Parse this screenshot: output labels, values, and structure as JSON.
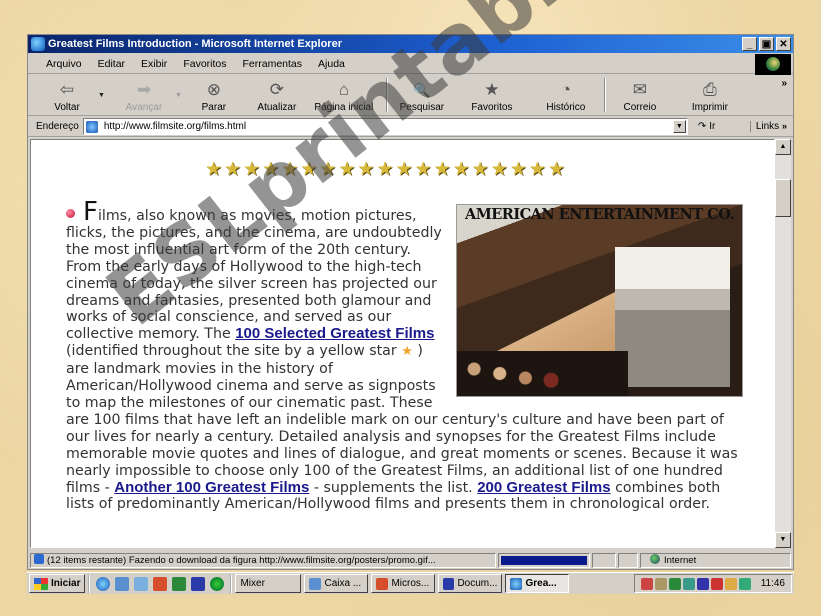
{
  "window": {
    "title": "Greatest Films Introduction - Microsoft Internet Explorer",
    "controls": {
      "minimize": "_",
      "restore": "▣",
      "close": "✕"
    }
  },
  "menu": [
    "Arquivo",
    "Editar",
    "Exibir",
    "Favoritos",
    "Ferramentas",
    "Ajuda"
  ],
  "menu_access_keys": [
    "A",
    "E",
    "x",
    "F",
    "m",
    "j"
  ],
  "toolbar": {
    "buttons": [
      {
        "label": "Voltar",
        "icon": "back-arrow-icon",
        "glyph": "⇦",
        "enabled": true,
        "dropdown": true
      },
      {
        "label": "Avançar",
        "icon": "forward-arrow-icon",
        "glyph": "➡",
        "enabled": false,
        "dropdown": true
      },
      {
        "label": "Parar",
        "icon": "stop-icon",
        "glyph": "⊗",
        "enabled": true
      },
      {
        "label": "Atualizar",
        "icon": "refresh-icon",
        "glyph": "⟳",
        "enabled": true
      },
      {
        "label": "Página inicial",
        "icon": "home-icon",
        "glyph": "⌂",
        "enabled": true
      },
      {
        "label": "Pesquisar",
        "icon": "search-icon",
        "glyph": "🔍",
        "enabled": true
      },
      {
        "label": "Favoritos",
        "icon": "favorites-folder-icon",
        "glyph": "★",
        "enabled": true
      },
      {
        "label": "Histórico",
        "icon": "history-icon",
        "glyph": "◔",
        "enabled": true
      },
      {
        "label": "Correio",
        "icon": "mail-icon",
        "glyph": "✉",
        "enabled": true,
        "dropdown": true
      },
      {
        "label": "Imprimir",
        "icon": "printer-icon",
        "glyph": "⎙",
        "enabled": true
      }
    ],
    "more": "»"
  },
  "address": {
    "label": "Endereço",
    "url": "http://www.filmsite.org/films.html",
    "go_label": "Ir",
    "links_label": "Links",
    "links_more": "»"
  },
  "page": {
    "star_count": 19,
    "star_glyph": "★",
    "poster_title": "AMERICAN ENTERTAINMENT CO.",
    "paragraph": {
      "dropcap": "F",
      "part1": "ilms, also known as movies, motion pictures, flicks, the pictures, and the cinema, are undoubtedly the most influential art form of the 20th century. From the early days of Hollywood to the high-tech cinema of today, the silver screen has projected our dreams and fantasies, presented both glamour and works of social conscience, and served as our collective memory. The ",
      "link1": "100 Selected Greatest Films",
      "part2": " (identified throughout the site by a yellow star ",
      "part3": " ) are landmark movies in the history of American/Hollywood cinema and serve as signposts to map the milestones of our cinematic past. These are 100 films that have left an indelible mark on our century's culture and have been part of our lives for nearly a century. Detailed analysis and synopses for the Greatest Films include memorable movie quotes and lines of dialogue, and great moments or scenes. Because it was nearly impossible to choose only 100 of the Greatest Films, an additional list of one hundred films - ",
      "link2": "Another 100 Greatest Films",
      "part4": " - supplements the list. ",
      "link3": "200 Greatest Films",
      "part5": " combines both lists of predominantly American/Hollywood films and presents them in chronological order."
    }
  },
  "status": {
    "message": "(12 items restante) Fazendo o download da figura http://www.filmsite.org/posters/promo.gif...",
    "progress": 1.0,
    "zone": "Internet"
  },
  "taskbar": {
    "start_label": "Iniciar",
    "quick_launch": [
      "ie-icon",
      "outlook-icon",
      "edit-icon",
      "powerpoint-icon",
      "excel-icon",
      "word-icon",
      "clover-icon"
    ],
    "tasks": [
      {
        "label": "Mixer",
        "active": false
      },
      {
        "label": "Caixa ...",
        "active": false
      },
      {
        "label": "Micros...",
        "active": false
      },
      {
        "label": "Docum...",
        "active": false
      },
      {
        "label": "Grea...",
        "active": true
      }
    ],
    "clock": "11:46"
  },
  "watermark": "ESLprintables.com",
  "colors": {
    "titlebar_start": "#0a246a",
    "titlebar_end": "#3a8ee8",
    "link": "#1a1a8c",
    "star": "#d9b93a",
    "progress": "#0a1a8c"
  }
}
